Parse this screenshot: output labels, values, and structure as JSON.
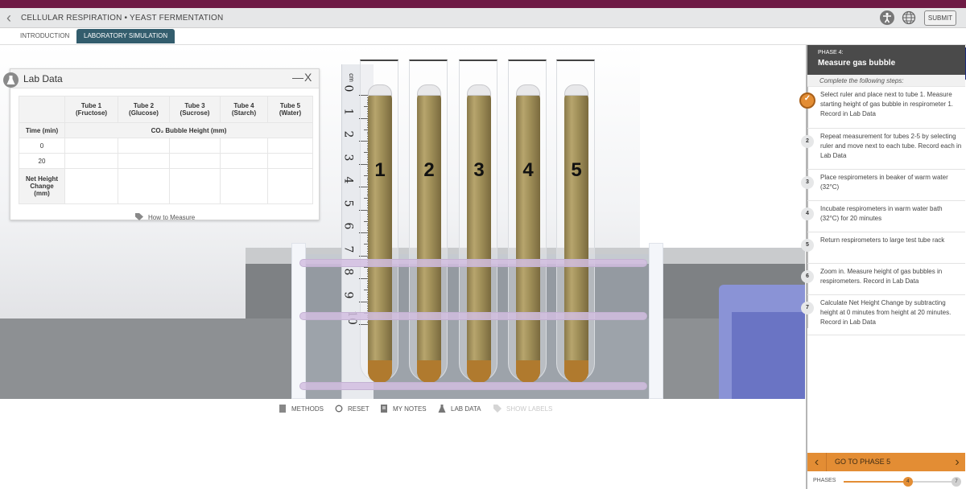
{
  "app": {
    "title": "CELLULAR RESPIRATION • YEAST FERMENTATION",
    "submit_label": "SUBMIT",
    "tabs": [
      {
        "label": "INTRODUCTION",
        "active": false
      },
      {
        "label": "LABORATORY SIMULATION",
        "active": true
      }
    ]
  },
  "scene": {
    "ruler_unit": "cm",
    "ruler_numbers": [
      "0",
      "1",
      "2",
      "3",
      "4",
      "5",
      "6",
      "7",
      "8",
      "9",
      "10"
    ],
    "tubes": [
      "1",
      "2",
      "3",
      "4",
      "5"
    ],
    "colors": {
      "liquid": "#a8955f",
      "rack_bar": "#d2bee1",
      "beaker": "#8a93d6"
    }
  },
  "toolbar": {
    "methods": "METHODS",
    "reset": "RESET",
    "my_notes": "MY NOTES",
    "lab_data": "LAB DATA",
    "show_labels": "SHOW LABELS"
  },
  "lab_data": {
    "title": "Lab Data",
    "minimize": "—",
    "close": "X",
    "columns": [
      {
        "name": "Tube 1",
        "sub": "(Fructose)"
      },
      {
        "name": "Tube 2",
        "sub": "(Glucose)"
      },
      {
        "name": "Tube 3",
        "sub": "(Sucrose)"
      },
      {
        "name": "Tube 4",
        "sub": "(Starch)"
      },
      {
        "name": "Tube 5",
        "sub": "(Water)"
      }
    ],
    "time_header": "Time (min)",
    "measure_header": "CO₂ Bubble Height (mm)",
    "rows": [
      {
        "label": "0",
        "values": [
          "",
          "",
          "",
          "",
          ""
        ]
      },
      {
        "label": "20",
        "values": [
          "",
          "",
          "",
          "",
          ""
        ]
      }
    ],
    "net_row": {
      "label_1": "Net Height",
      "label_2": "Change",
      "label_3": "(mm)",
      "values": [
        "",
        "",
        "",
        "",
        ""
      ]
    },
    "how_to_measure": "How to Measure"
  },
  "sidebar": {
    "phase_label": "PHASE 4:",
    "phase_title": "Measure gas bubble",
    "instructions": "Complete the following steps:",
    "steps": [
      {
        "num": "✓",
        "done": true,
        "text": "Select ruler and place next to tube 1. Measure starting height of gas bubble in respirometer 1. Record in Lab Data"
      },
      {
        "num": "2",
        "done": false,
        "text": "Repeat measurement for tubes 2-5 by selecting ruler and move next to each tube. Record each in Lab Data"
      },
      {
        "num": "3",
        "done": false,
        "text": "Place respirometers in beaker of warm water (32°C)"
      },
      {
        "num": "4",
        "done": false,
        "text": "Incubate respirometers in warm water bath (32°C) for 20 minutes"
      },
      {
        "num": "5",
        "done": false,
        "text": "Return respirometers to large test tube rack"
      },
      {
        "num": "6",
        "done": false,
        "text": "Zoom in. Measure height of gas bubbles in respirometers. Record in Lab Data"
      },
      {
        "num": "7",
        "done": false,
        "text": "Calculate Net Height Change by subtracting height at 0 minutes from height at 20 minutes. Record in Lab Data"
      }
    ],
    "go_phase_label": "GO TO PHASE 5",
    "phases_label": "PHASES",
    "current_phase": "4",
    "total_phases": "7",
    "phase_progress": 0.57,
    "accent_color": "#e38d34"
  }
}
